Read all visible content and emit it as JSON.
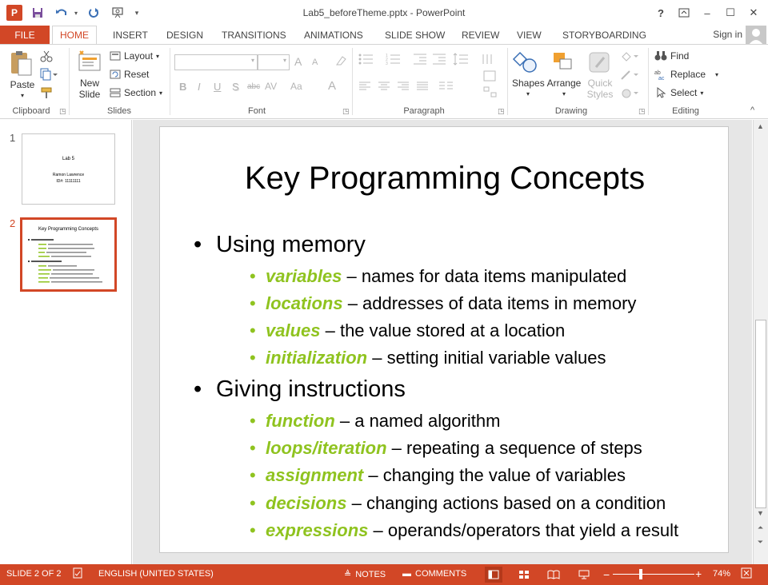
{
  "window": {
    "title": "Lab5_beforeTheme.pptx - PowerPoint",
    "app_icon": "P",
    "controls": {
      "help": "?",
      "restore_ribbon": "▭",
      "minimize": "–",
      "maximize": "☐",
      "close": "✕"
    }
  },
  "qat": {
    "save": "save-icon",
    "undo": "undo-icon",
    "redo": "redo-icon",
    "present": "present-icon"
  },
  "tabs": {
    "file": "FILE",
    "items": [
      "HOME",
      "INSERT",
      "DESIGN",
      "TRANSITIONS",
      "ANIMATIONS",
      "SLIDE SHOW",
      "REVIEW",
      "VIEW",
      "STORYBOARDING"
    ],
    "active": "HOME",
    "signin": "Sign in"
  },
  "ribbon": {
    "clipboard": {
      "label": "Clipboard",
      "paste": "Paste"
    },
    "slides": {
      "label": "Slides",
      "new_slide_1": "New",
      "new_slide_2": "Slide",
      "layout": "Layout",
      "reset": "Reset",
      "section": "Section"
    },
    "font": {
      "label": "Font",
      "bold": "B",
      "italic": "I",
      "underline": "U",
      "shadow": "S",
      "strike": "abc",
      "spacing": "AV",
      "case": "Aa",
      "color": "A",
      "grow": "A",
      "shrink": "A"
    },
    "paragraph": {
      "label": "Paragraph"
    },
    "drawing": {
      "label": "Drawing",
      "shapes": "Shapes",
      "arrange": "Arrange",
      "quick_styles_1": "Quick",
      "quick_styles_2": "Styles"
    },
    "editing": {
      "label": "Editing",
      "find": "Find",
      "replace": "Replace",
      "select": "Select"
    }
  },
  "thumbnails": [
    {
      "number": "1",
      "title": "Lab 5",
      "line1": "Ramon Lawrence",
      "line2": "ID#: 11111111"
    },
    {
      "number": "2",
      "title": "Key Programming Concepts"
    }
  ],
  "slide": {
    "title": "Key Programming Concepts",
    "sections": [
      {
        "heading": "Using memory",
        "items": [
          {
            "keyword": "variables",
            "text": " – names for data items manipulated"
          },
          {
            "keyword": "locations",
            "text": " – addresses of data items in memory"
          },
          {
            "keyword": "values",
            "text": " – the value stored at a location"
          },
          {
            "keyword": "initialization",
            "text": " – setting initial variable values"
          }
        ]
      },
      {
        "heading": "Giving instructions",
        "items": [
          {
            "keyword": "function",
            "text": " – a named algorithm"
          },
          {
            "keyword": "loops/iteration",
            "text": " – repeating a sequence of steps"
          },
          {
            "keyword": "assignment",
            "text": " – changing the value of variables"
          },
          {
            "keyword": "decisions",
            "text": " – changing actions based on a condition"
          },
          {
            "keyword": "expressions",
            "text": " – operands/operators that yield a result"
          }
        ]
      }
    ]
  },
  "status": {
    "slide_indicator": "SLIDE 2 OF 2",
    "language": "ENGLISH (UNITED STATES)",
    "notes": "NOTES",
    "comments": "COMMENTS",
    "zoom": "74%",
    "zoom_minus": "−",
    "zoom_plus": "+"
  },
  "colors": {
    "accent": "#d24726",
    "keyword": "#8fc31f"
  }
}
